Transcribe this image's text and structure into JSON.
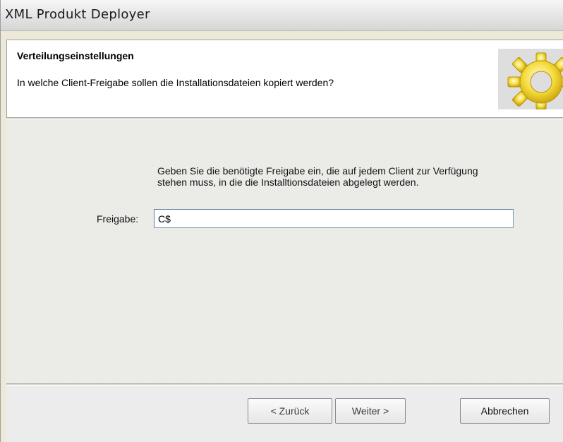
{
  "window": {
    "title": "XML Produkt Deployer"
  },
  "header": {
    "title": "Verteilungseinstellungen",
    "subtitle": "In welche Client-Freigabe sollen die Installationsdateien kopiert werden?",
    "logo_icon": "gear-icon",
    "logo_color": "#f2d52a"
  },
  "form": {
    "instruction": "Geben Sie die benötigte Freigabe ein, die auf jedem Client zur Verfügung stehen muss, in die die Installtionsdateien abgelegt werden.",
    "share_label": "Freigabe:",
    "share_value": "C$"
  },
  "buttons": {
    "back": "< Zurück",
    "next": "Weiter >",
    "cancel": "Abbrechen"
  }
}
